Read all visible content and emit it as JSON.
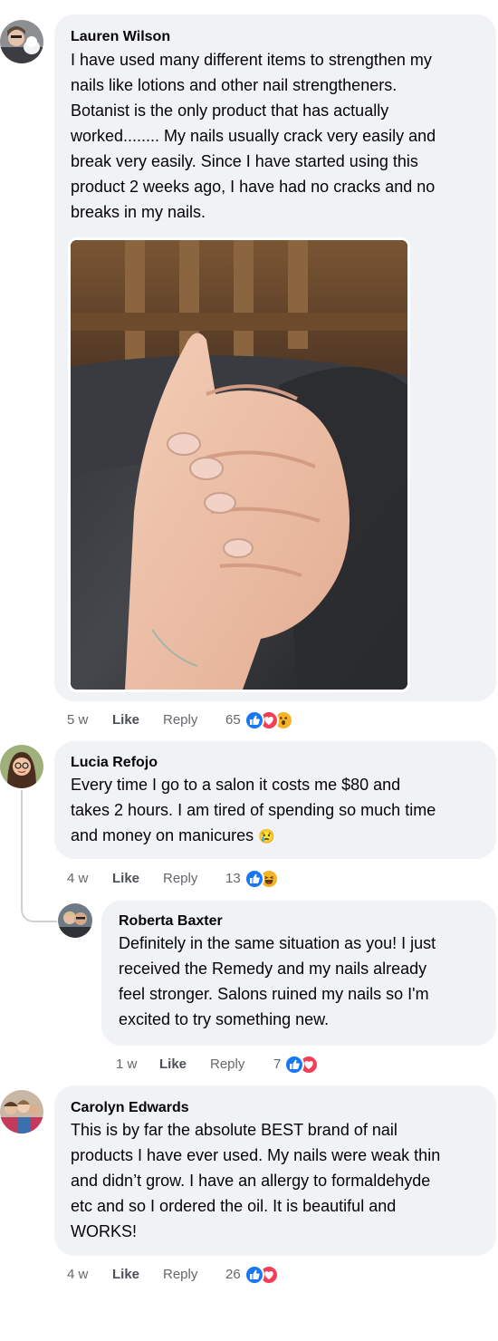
{
  "comments": [
    {
      "author": "Lauren Wilson",
      "lines": [
        "I have used many different items to strengthen my",
        "nails like lotions and other nail strengtheners.",
        "Botanist is the only product that has actually",
        "worked........ My nails usually crack very easily and",
        "break very easily. Since I have started using this",
        "product 2 weeks ago, I have had no cracks and no",
        "breaks in my nails."
      ],
      "time": "5 w",
      "like": "Like",
      "reply": "Reply",
      "reaction_count": "65",
      "reactions": [
        "like",
        "love",
        "wow"
      ]
    },
    {
      "author": "Lucia Refojo",
      "lines": [
        "Every time I go to a salon it costs me $80 and",
        "takes 2 hours. I am tired of spending so much time",
        "and money on manicures"
      ],
      "emoji": "😢",
      "time": "4 w",
      "like": "Like",
      "reply": "Reply",
      "reaction_count": "13",
      "reactions": [
        "like",
        "haha"
      ]
    },
    {
      "author": "Roberta Baxter",
      "lines": [
        "Definitely in the same situation as you! I just",
        "received the Remedy and my nails already",
        "feel stronger. Salons ruined my nails so I'm",
        "excited to try something new."
      ],
      "time": "1 w",
      "like": "Like",
      "reply": "Reply",
      "reaction_count": "7",
      "reactions": [
        "like",
        "love"
      ]
    },
    {
      "author": "Carolyn Edwards",
      "lines": [
        "This is by far the absolute BEST brand of nail",
        "products I have ever used. My nails were weak thin",
        "and didn’t grow. I have an allergy to formaldehyde",
        "etc and so I ordered the oil. It is beautiful and",
        "WORKS!"
      ],
      "time": "4 w",
      "like": "Like",
      "reply": "Reply",
      "reaction_count": "26",
      "reactions": [
        "like",
        "love"
      ]
    }
  ],
  "colors": {
    "bubble": "#f0f2f5",
    "meta_text": "#65676b",
    "like_blue": "#1877f2",
    "love_red": "#f33e58",
    "emoji_yellow": "#f7b125"
  }
}
